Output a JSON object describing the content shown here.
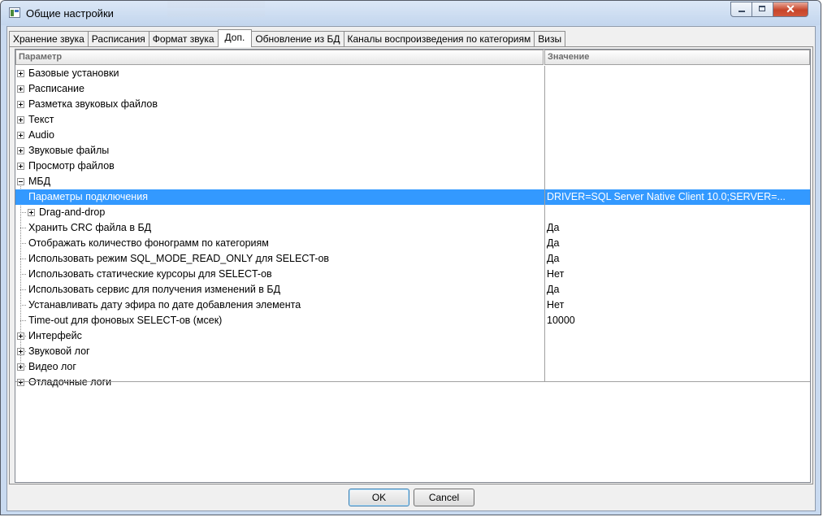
{
  "window": {
    "title": "Общие настройки",
    "close_glyph": "✕"
  },
  "tabs": [
    {
      "label": "Хранение звука",
      "active": false
    },
    {
      "label": "Расписания",
      "active": false
    },
    {
      "label": "Формат звука",
      "active": false
    },
    {
      "label": "Доп.",
      "active": true
    },
    {
      "label": "Обновление из БД",
      "active": false
    },
    {
      "label": "Каналы воспроизведения по категориям",
      "active": false
    },
    {
      "label": "Визы",
      "active": false
    }
  ],
  "grid": {
    "col_param": "Параметр",
    "col_value": "Значение",
    "rows": [
      {
        "label": "Базовые установки",
        "value": ""
      },
      {
        "label": "Расписание",
        "value": ""
      },
      {
        "label": "Разметка звуковых файлов",
        "value": ""
      },
      {
        "label": "Текст",
        "value": ""
      },
      {
        "label": "Audio",
        "value": ""
      },
      {
        "label": "Звуковые файлы",
        "value": ""
      },
      {
        "label": "Просмотр файлов",
        "value": ""
      },
      {
        "label": "МБД",
        "value": ""
      },
      {
        "label": "Параметры подключения",
        "value": "DRIVER=SQL Server Native Client 10.0;SERVER=..."
      },
      {
        "label": "Drag-and-drop",
        "value": ""
      },
      {
        "label": "Хранить CRC файла в БД",
        "value": "Да"
      },
      {
        "label": "Отображать количество фонограмм по категориям",
        "value": "Да"
      },
      {
        "label": "Использовать режим SQL_MODE_READ_ONLY для SELECT-ов",
        "value": "Да"
      },
      {
        "label": "Использовать статические курсоры для SELECT-ов",
        "value": "Нет"
      },
      {
        "label": "Использовать сервис для получения изменений в БД",
        "value": "Да"
      },
      {
        "label": "Устанавливать дату эфира по дате добавления элемента",
        "value": "Нет"
      },
      {
        "label": "Time-out для фоновых SELECT-ов (мсек)",
        "value": "10000"
      },
      {
        "label": "Интерфейс",
        "value": ""
      },
      {
        "label": "Звуковой лог",
        "value": ""
      },
      {
        "label": "Видео лог",
        "value": ""
      },
      {
        "label": "Отладочные логи",
        "value": ""
      }
    ]
  },
  "buttons": {
    "ok": "OK",
    "cancel": "Cancel"
  },
  "colors": {
    "selection": "#3399ff"
  }
}
